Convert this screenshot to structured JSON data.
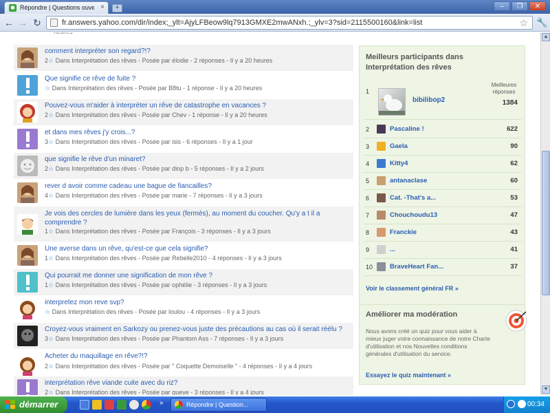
{
  "browser": {
    "tab_title": "Répondre | Questions ouverte",
    "url": "fr.answers.yahoo.com/dir/index;_ylt=AjyLFBeow9lq7913GMXE2mwANxh.;_ylv=3?sid=2115500160&link=list",
    "newtab_symbol": "+",
    "close_tab_symbol": "×"
  },
  "page": {
    "top_fragment": "heures",
    "questions": [
      {
        "title": "comment interpréter son regard?!?",
        "meta": "2☆ Dans Interprétation des rêves - Posée par élodie - 2 réponses - Il y a 20 heures",
        "avatar": "photo-woman"
      },
      {
        "title": "Que signifie ce rêve de fuite ?",
        "meta": "☆ Dans Interprétation des rêves - Posée par B8tu - 1 réponse - Il y a 20 heures",
        "avatar": "exclamation-blue"
      },
      {
        "title": "Pouvez-vous m'aider à interpréter un rêve de catastrophe en vacances ?",
        "meta": "2☆ Dans Interprétation des rêves - Posée par Chev - 1 réponse - Il y a 20 heures",
        "avatar": "cartoon-redhead"
      },
      {
        "title": "et dans mes rêves j'y crois...?",
        "meta": "3☆ Dans Interprétation des rêves - Posée par isis - 6 réponses - Il y a 1 jour",
        "avatar": "exclamation-purple"
      },
      {
        "title": "que signifie le rêve d'un minaret?",
        "meta": "2☆ Dans Interprétation des rêves - Posée par diop b - 5 réponses - Il y a 2 jours",
        "avatar": "default-face"
      },
      {
        "title": "rever d avoir comme cadeau une bague de fiancailles?",
        "meta": "4☆ Dans Interprétation des rêves - Posée par marie - 7 réponses - Il y a 3 jours",
        "avatar": "photo-woman"
      },
      {
        "title": "Je vois des cercles de lumière dans les yeux (fermés), au moment du coucher. Qu'y a t il a comprendre ?",
        "meta": "1☆ Dans Interprétation des rêves - Posée par François - 3 réponses - Il y a 3 jours",
        "avatar": "cartoon-boy"
      },
      {
        "title": "Une averse dans un rêve, qu'est-ce que cela signifie?",
        "meta": "1☆ Dans Interprétation des rêves - Posée par Rebelle2010 - 4 réponses - Il y a 3 jours",
        "avatar": "photo-woman"
      },
      {
        "title": "Qui pourrait me donner une signification de mon rêve ?",
        "meta": "1☆ Dans Interprétation des rêves - Posée par ophélie - 3 réponses - Il y a 3 jours",
        "avatar": "exclamation-teal"
      },
      {
        "title": "interpretez mon reve svp?",
        "meta": "☆ Dans Interprétation des rêves - Posée par loulou - 4 réponses - Il y a 3 jours",
        "avatar": "cartoon-girl"
      },
      {
        "title": "Croyez-vous vraiment en Sarkozy ou prenez-vous juste des précautions au cas où il serait réélu ?",
        "meta": "3☆ Dans Interprétation des rêves - Posée par Phantom Ass - 7 réponses - Il y a 3 jours",
        "avatar": "dark-face"
      },
      {
        "title": "Acheter du maquillage en rêve?!?",
        "meta": "2☆ Dans Interprétation des rêves - Posée par \" Coquette Demoiselle \" - 4 réponses - Il y a 4 jours",
        "avatar": "cartoon-girl"
      },
      {
        "title": "interprétation rêve viande cuite avec du riz?",
        "meta": "2☆ Dans Interprétation des rêves - Posée par gueye - 3 réponses - Il y a 4 jours",
        "avatar": "exclamation-purple"
      }
    ]
  },
  "sidebar": {
    "leaders": {
      "title": "Meilleurs participants dans Interprétation des rêves",
      "best_answers_label": "Meilleures réponses",
      "top": {
        "rank": "1",
        "name": "bibilibop2",
        "score": "1384"
      },
      "rows": [
        {
          "rank": "2",
          "name": "Pascaline !",
          "score": "622",
          "color": "#4a3a5a"
        },
        {
          "rank": "3",
          "name": "Gaela",
          "score": "90",
          "color": "#f0b020"
        },
        {
          "rank": "4",
          "name": "Kitty4",
          "score": "62",
          "color": "#3a7ad0"
        },
        {
          "rank": "5",
          "name": "antanaclase",
          "score": "60",
          "color": "#c9a070"
        },
        {
          "rank": "6",
          "name": "Cat. -That's a...",
          "score": "53",
          "color": "#7a5a4a"
        },
        {
          "rank": "7",
          "name": "Chouchoudu13",
          "score": "47",
          "color": "#b88a6a"
        },
        {
          "rank": "8",
          "name": "Franckie",
          "score": "43",
          "color": "#d89a70"
        },
        {
          "rank": "9",
          "name": "...",
          "score": "41",
          "color": "#cfcfcf"
        },
        {
          "rank": "10",
          "name": "BraveHeart Fan...",
          "score": "37",
          "color": "#8a8f9a"
        }
      ],
      "link": "Voir le classement général FR »"
    },
    "moderation": {
      "title": "Améliorer ma modération",
      "text": "Nous avons créé un quiz pour vous aider à mieux juger votre connaissance de notre Charte d'utilisation et nos Nouvelles conditions générales d'utilisation du service.",
      "link": "Essayez le quiz maintenant »"
    }
  },
  "taskbar": {
    "start_label": "démarrer",
    "task_label": "Répondre | Question...",
    "clock": "00:34",
    "chevron": "»"
  }
}
